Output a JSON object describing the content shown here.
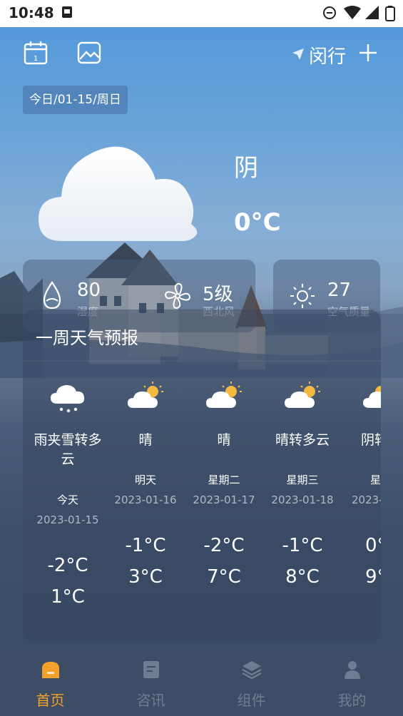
{
  "status_bar": {
    "time": "10:48"
  },
  "header": {
    "city": "闵行"
  },
  "date_chip": "今日/01-15/周日",
  "current": {
    "condition": "阴",
    "temperature": "0°C"
  },
  "details": {
    "humidity": {
      "value": "80",
      "label": "湿度"
    },
    "wind": {
      "value": "5级",
      "label": "西北风"
    },
    "air": {
      "value": "27",
      "label": "空气质量"
    }
  },
  "forecast": {
    "title": "一周天气预报",
    "days": [
      {
        "desc": "雨夹雪转多云",
        "name": "今天",
        "date": "2023-01-15",
        "low": "-2°C",
        "high": "1°C",
        "icon": "sleet-cloud-icon"
      },
      {
        "desc": "晴",
        "name": "明天",
        "date": "2023-01-16",
        "low": "-1°C",
        "high": "3°C",
        "icon": "sun-cloud-icon"
      },
      {
        "desc": "晴",
        "name": "星期二",
        "date": "2023-01-17",
        "low": "-2°C",
        "high": "7°C",
        "icon": "sun-cloud-icon"
      },
      {
        "desc": "晴转多云",
        "name": "星期三",
        "date": "2023-01-18",
        "low": "-1°C",
        "high": "8°C",
        "icon": "sun-cloud-icon"
      },
      {
        "desc": "阴转",
        "name": "星期",
        "date": "2023-",
        "low": "0°",
        "high": "9°",
        "icon": "sun-cloud-icon"
      }
    ]
  },
  "bottom_nav": [
    {
      "label": "首页",
      "icon": "home-icon",
      "active": true
    },
    {
      "label": "咨讯",
      "icon": "news-icon",
      "active": false
    },
    {
      "label": "组件",
      "icon": "layers-icon",
      "active": false
    },
    {
      "label": "我的",
      "icon": "user-icon",
      "active": false
    }
  ],
  "colors": {
    "accent": "#f3a12a",
    "nav_bg": "#3e4d66",
    "inactive": "#6f7d93"
  }
}
